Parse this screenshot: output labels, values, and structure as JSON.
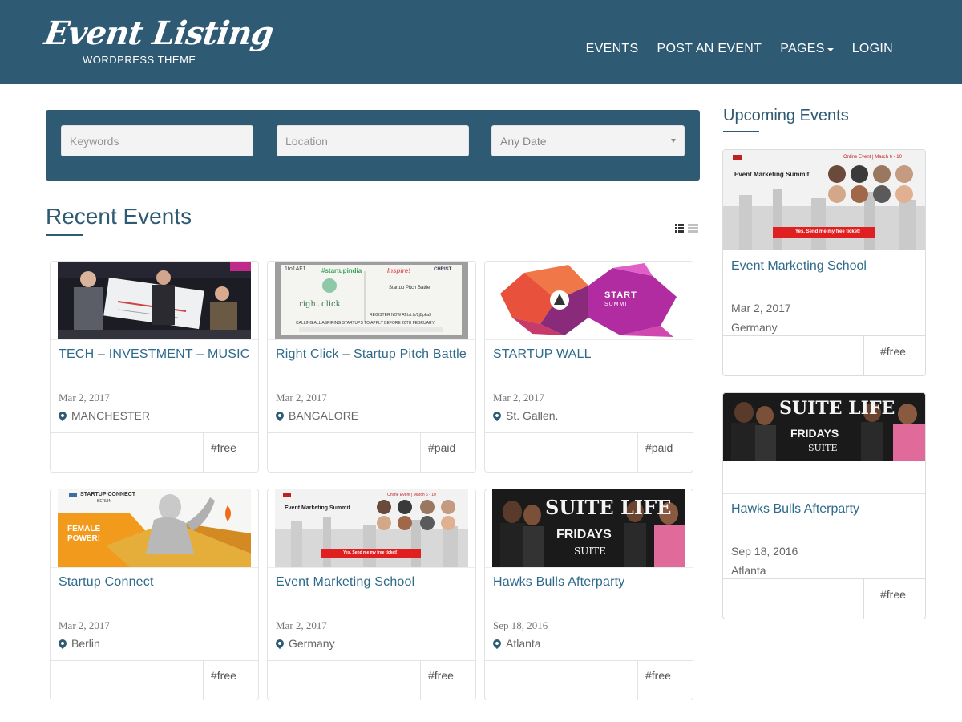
{
  "header": {
    "logo_script": "Event Listing",
    "logo_sub": "WORDPRESS THEME",
    "nav": [
      {
        "label": "EVENTS"
      },
      {
        "label": "POST AN EVENT"
      },
      {
        "label": "PAGES"
      },
      {
        "label": "LOGIN"
      }
    ]
  },
  "search": {
    "keywords_placeholder": "Keywords",
    "location_placeholder": "Location",
    "date_value": "Any Date"
  },
  "main": {
    "title": "Recent Events",
    "events": [
      {
        "title": "TECH – INVESTMENT – MUSIC",
        "date": "Mar 2, 2017",
        "location": "MANCHESTER",
        "tag": "#free"
      },
      {
        "title": "Right Click – Startup Pitch Battle",
        "date": "Mar 2, 2017",
        "location": "BANGALORE",
        "tag": "#paid",
        "image_text": {
          "brand": "1to1AF1",
          "hashtag": "#startupindia",
          "inspire": "Inspire!",
          "christ": "CHRIST",
          "rightclick": "right click",
          "heading": "Startup Pitch Battle",
          "register": "REGISTER NOW AT:bit.ly/2jBpka3",
          "calling": "CALLING ALL ASPIRING STARTUPS TO APPLY BEFORE 20TH FEBRUARY"
        }
      },
      {
        "title": "STARTUP WALL",
        "date": "Mar 2, 2017",
        "location": "St. Gallen.",
        "tag": "#paid",
        "image_text": {
          "start": "START",
          "summit": "SUMMIT"
        }
      },
      {
        "title": "Startup Connect",
        "date": "Mar 2, 2017",
        "location": "Berlin",
        "tag": "#free",
        "image_text": {
          "brand": "STARTUP CONNECT",
          "city": "BERLIN",
          "female": "FEMALE",
          "power": "POWER!"
        }
      },
      {
        "title": "Event Marketing School",
        "date": "Mar 2, 2017",
        "location": "Germany",
        "tag": "#free",
        "image_text": {
          "heading": "Event Marketing Summit",
          "online": "Online Event | March 6 - 10",
          "cta": "Yes, Send me my free ticket!"
        }
      },
      {
        "title": "Hawks Bulls Afterparty",
        "date": "Sep 18, 2016",
        "location": "Atlanta",
        "tag": "#free",
        "image_text": {
          "suite_life": "SUITE LIFE",
          "fridays": "FRIDAYS",
          "suite": "SUITE"
        }
      }
    ]
  },
  "sidebar": {
    "title": "Upcoming Events",
    "events": [
      {
        "title": "Event Marketing School",
        "date": "Mar 2, 2017",
        "location": "Germany",
        "tag": "#free",
        "image_text": {
          "heading": "Event Marketing Summit",
          "online": "Online Event | March 6 - 10",
          "cta": "Yes, Send me my free ticket!"
        }
      },
      {
        "title": "Hawks Bulls Afterparty",
        "date": "Sep 18, 2016",
        "location": "Atlanta",
        "tag": "#free",
        "image_text": {
          "suite_life": "SUITE LIFE",
          "fridays": "FRIDAYS",
          "suite": "SUITE"
        }
      }
    ]
  },
  "colors": {
    "primary": "#2e5a73",
    "link": "#2e6a8a",
    "cta_red": "#e02020"
  }
}
